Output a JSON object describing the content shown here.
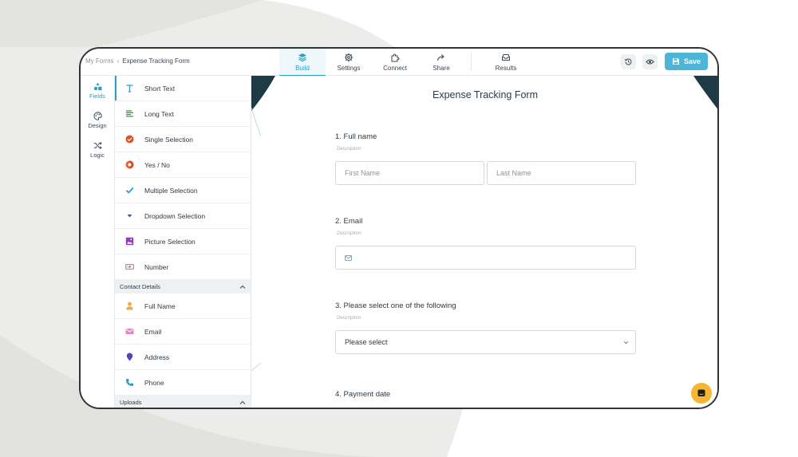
{
  "breadcrumb": {
    "root": "My Forms",
    "separator": "›",
    "current": "Expense Tracking Form"
  },
  "tabs": [
    {
      "label": "Build",
      "icon": "layers-icon",
      "active": true
    },
    {
      "label": "Settings",
      "icon": "gear-icon",
      "active": false
    },
    {
      "label": "Connect",
      "icon": "puzzle-icon",
      "active": false
    },
    {
      "label": "Share",
      "icon": "share-arrow-icon",
      "active": false
    },
    {
      "label": "Results",
      "icon": "inbox-icon",
      "active": false
    }
  ],
  "header_actions": {
    "history_icon": "history-icon",
    "preview_icon": "eye-icon",
    "save_label": "Save"
  },
  "rail": [
    {
      "label": "Fields",
      "icon": "shapes-icon",
      "active": true
    },
    {
      "label": "Design",
      "icon": "palette-icon",
      "active": false
    },
    {
      "label": "Logic",
      "icon": "shuffle-icon",
      "active": false
    }
  ],
  "fields": [
    {
      "label": "Short Text",
      "icon": "text-t-icon"
    },
    {
      "label": "Long Text",
      "icon": "paragraph-icon"
    },
    {
      "label": "Single Selection",
      "icon": "radio-check-icon"
    },
    {
      "label": "Yes / No",
      "icon": "yes-no-icon"
    },
    {
      "label": "Multiple Selection",
      "icon": "checkmark-icon"
    },
    {
      "label": "Dropdown Selection",
      "icon": "dropdown-icon"
    },
    {
      "label": "Picture Selection",
      "icon": "picture-icon"
    },
    {
      "label": "Number",
      "icon": "number-icon"
    }
  ],
  "contact_section": {
    "title": "Contact Details",
    "items": [
      {
        "label": "Full Name",
        "icon": "person-icon"
      },
      {
        "label": "Email",
        "icon": "envelope-icon"
      },
      {
        "label": "Address",
        "icon": "map-pin-icon"
      },
      {
        "label": "Phone",
        "icon": "phone-icon"
      }
    ]
  },
  "uploads_section": {
    "title": "Uploads"
  },
  "form": {
    "title": "Expense Tracking Form",
    "questions": [
      {
        "label": "1. Full name",
        "description": "Description",
        "first_placeholder": "First Name",
        "last_placeholder": "Last Name"
      },
      {
        "label": "2. Email",
        "description": "Description"
      },
      {
        "label": "3. Please select one of the following",
        "description": "Description",
        "select_value": "Please select"
      },
      {
        "label": "4. Payment date"
      }
    ]
  },
  "colors": {
    "accent": "#2aa0c4",
    "save": "#4db6d8",
    "chat": "#f5b731",
    "frame": "#2e3438"
  }
}
